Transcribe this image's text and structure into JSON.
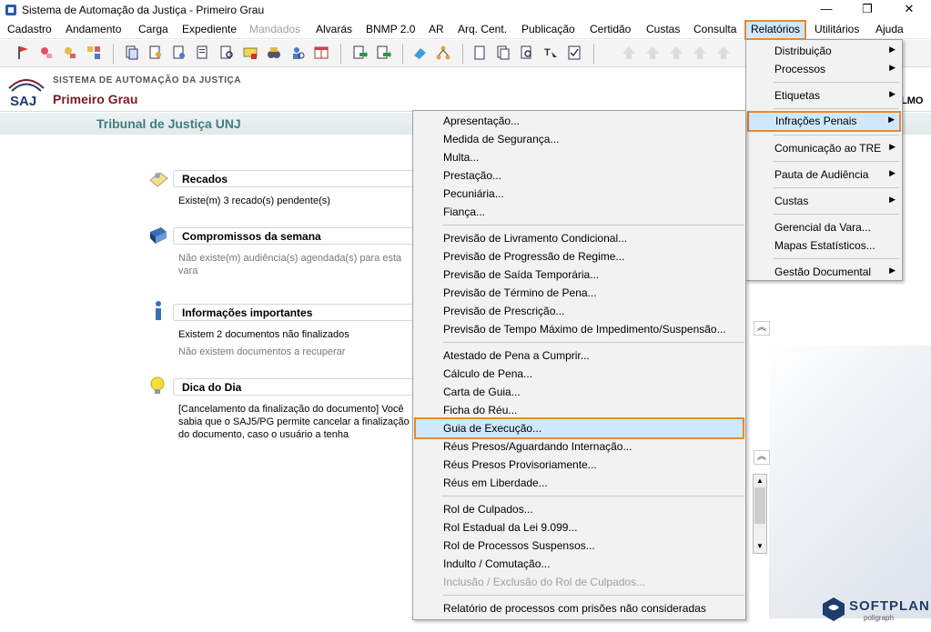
{
  "window": {
    "title": "Sistema de Automação da Justiça - Primeiro Grau",
    "minimize": "—",
    "restore": "❐",
    "close": "✕"
  },
  "menubar": {
    "items": [
      {
        "label": "Cadastro"
      },
      {
        "label": "Andamento"
      },
      {
        "label": "Carga"
      },
      {
        "label": "Expediente"
      },
      {
        "label": "Mandados",
        "disabled": true
      },
      {
        "label": "Alvarás"
      },
      {
        "label": "BNMP 2.0"
      },
      {
        "label": "AR"
      },
      {
        "label": "Arq. Cent."
      },
      {
        "label": "Publicação"
      },
      {
        "label": "Certidão"
      },
      {
        "label": "Custas"
      },
      {
        "label": "Consulta"
      },
      {
        "label": "Relatórios",
        "active": true
      },
      {
        "label": "Utilitários"
      },
      {
        "label": "Ajuda"
      }
    ]
  },
  "header": {
    "logo_text": "SAJ",
    "system_name": "SISTEMA DE AUTOMAÇÃO DA JUSTIÇA",
    "grau": "Primeiro Grau",
    "user_suffix": "LMO",
    "tribunal": "Tribunal de Justiça UNJ"
  },
  "sections": {
    "recados": {
      "title": "Recados",
      "text": "Existe(m) 3 recado(s) pendente(s)"
    },
    "compromissos": {
      "title": "Compromissos da semana",
      "text": "Não existe(m) audiência(s) agendada(s) para esta vara"
    },
    "informacoes": {
      "title": "Informações importantes",
      "text1": "Existem 2 documentos não finalizados",
      "text2": "Não existem documentos a recuperar"
    },
    "dica": {
      "title": "Dica do Dia",
      "text": "[Cancelamento da finalização do documento] Você sabia que o SAJ5/PG permite cancelar a finalização do documento, caso o usuário a tenha"
    }
  },
  "relatorios_menu": {
    "items": [
      {
        "label": "Distribuição",
        "arrow": "▶"
      },
      {
        "label": "Processos",
        "arrow": "▶"
      },
      {
        "label": "Etiquetas",
        "arrow": "▶"
      },
      {
        "label": "Infrações Penais",
        "arrow": "▶"
      },
      {
        "label": "Comunicação ao TRE",
        "arrow": "▶"
      },
      {
        "label": "Pauta de Audiência",
        "arrow": "▶"
      },
      {
        "label": "Custas",
        "arrow": "▶"
      },
      {
        "label": "Gerencial da Vara..."
      },
      {
        "label": "Mapas Estatísticos..."
      },
      {
        "label": "Gestão Documental",
        "arrow": "▶"
      }
    ]
  },
  "infracoes_menu": {
    "items": [
      {
        "label": "Apresentação..."
      },
      {
        "label": "Medida de Segurança..."
      },
      {
        "label": "Multa..."
      },
      {
        "label": "Prestação..."
      },
      {
        "label": "Pecuniária..."
      },
      {
        "label": "Fiança..."
      },
      {
        "label": "Previsão de Livramento Condicional..."
      },
      {
        "label": "Previsão de Progressão de Regime..."
      },
      {
        "label": "Previsão de Saída Temporária..."
      },
      {
        "label": "Previsão de Término de Pena..."
      },
      {
        "label": "Previsão de Prescrição..."
      },
      {
        "label": "Previsão de Tempo Máximo de Impedimento/Suspensão..."
      },
      {
        "label": "Atestado de Pena a Cumprir..."
      },
      {
        "label": "Cálculo de Pena..."
      },
      {
        "label": "Carta de Guia..."
      },
      {
        "label": "Ficha do Réu..."
      },
      {
        "label": "Guia de Execução..."
      },
      {
        "label": "Réus Presos/Aguardando Internação..."
      },
      {
        "label": "Réus Presos Provisoriamente..."
      },
      {
        "label": "Réus em Liberdade..."
      },
      {
        "label": "Rol de Culpados..."
      },
      {
        "label": "Rol Estadual da Lei 9.099..."
      },
      {
        "label": "Rol de Processos Suspensos..."
      },
      {
        "label": "Indulto / Comutação..."
      },
      {
        "label": "Inclusão / Exclusão do Rol de Culpados..."
      },
      {
        "label": "Relatório de processos com prisões não consideradas"
      }
    ]
  },
  "branding": {
    "name": "SOFTPLAN",
    "sub": "poligraph"
  },
  "colors": {
    "highlight": "#cde8ff",
    "outline": "#e8892e",
    "brand": "#7a1b2a"
  }
}
